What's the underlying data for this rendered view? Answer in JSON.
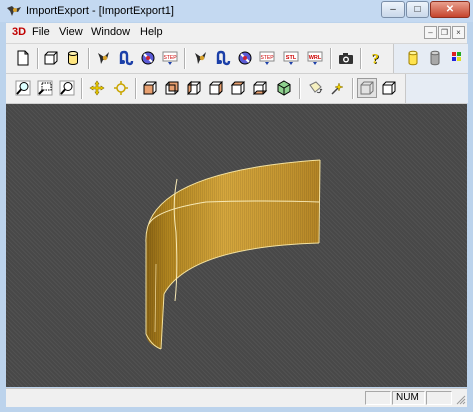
{
  "window": {
    "title": "ImportExport - [ImportExport1]",
    "minimize_glyph": "–",
    "maximize_glyph": "□",
    "close_glyph": "✕"
  },
  "menu": {
    "logo": "3D",
    "items": [
      "File",
      "View",
      "Window",
      "Help"
    ],
    "mdi_minimize": "–",
    "mdi_restore": "❐",
    "mdi_close": "×"
  },
  "toolbar1": {
    "labels": {
      "step_1": "STEP",
      "step_2": "STEP",
      "stl": "STL",
      "vrml": "WRL"
    }
  },
  "status": {
    "num": "NUM"
  },
  "colors": {
    "surface": "#c9962e",
    "background": "#484848",
    "accent": "#cc0000"
  }
}
